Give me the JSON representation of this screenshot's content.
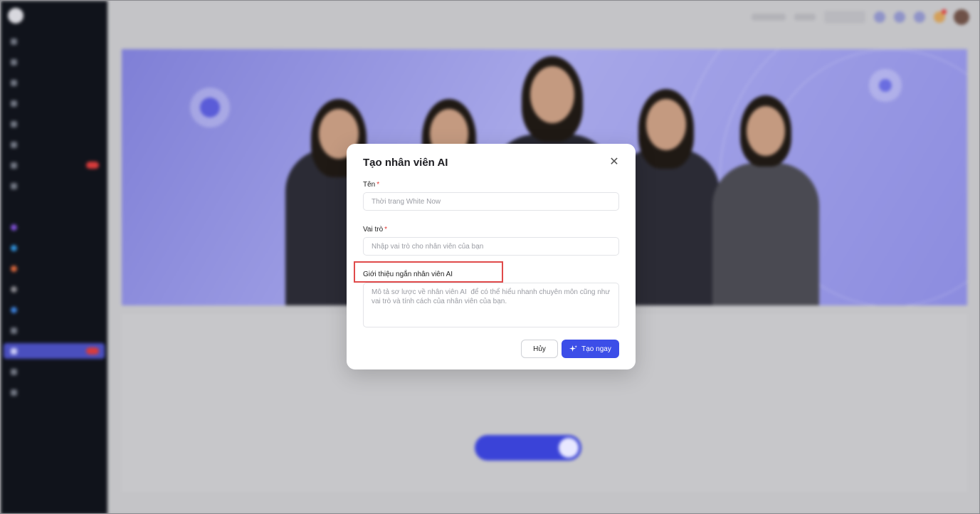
{
  "modal": {
    "title": "Tạo nhân viên AI",
    "fields": {
      "name": {
        "label": "Tên",
        "required_mark": "*",
        "placeholder": "Thời trang White Now"
      },
      "role": {
        "label": "Vai trò",
        "required_mark": "*",
        "placeholder": "Nhập vai trò cho nhân viên của bạn"
      },
      "intro": {
        "label": "Giới thiệu ngắn nhân viên AI",
        "placeholder": "Mô tả sơ lược về nhân viên AI  để có thể hiểu nhanh chuyên môn cũng như vai trò và tính cách của nhân viên của bạn."
      }
    },
    "buttons": {
      "cancel": "Hủy",
      "create": "Tạo ngay"
    }
  },
  "icons": {
    "close": "close-icon",
    "sparkle": "sparkle-icon"
  },
  "colors": {
    "primary": "#3c4ee8",
    "required": "#e53935",
    "highlight": "#e04a4a",
    "sidebar_bg": "#10131b"
  }
}
